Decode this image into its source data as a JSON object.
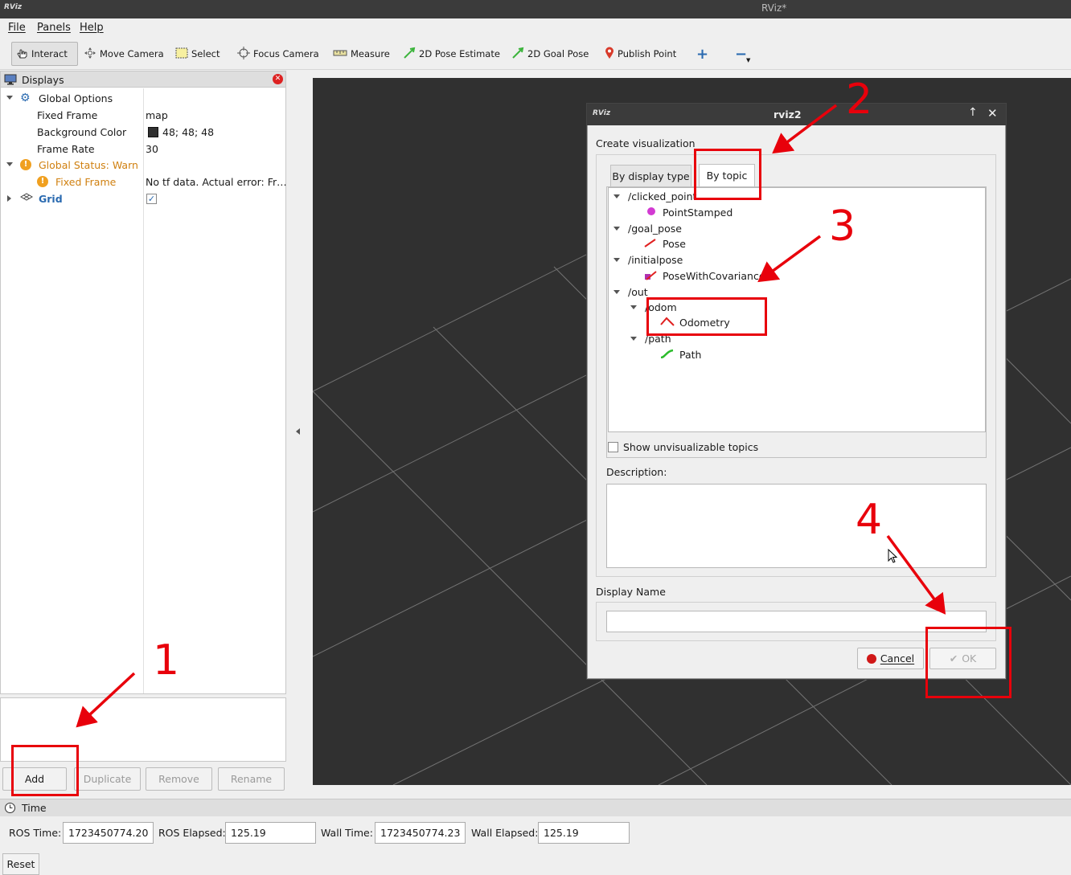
{
  "window": {
    "logo": "RViz",
    "title": "RViz*"
  },
  "menu": {
    "file": "File",
    "panels": "Panels",
    "help": "Help"
  },
  "toolbar": {
    "interact": "Interact",
    "move_camera": "Move Camera",
    "select": "Select",
    "focus_camera": "Focus Camera",
    "measure": "Measure",
    "pose_estimate": "2D Pose Estimate",
    "goal_pose": "2D Goal Pose",
    "publish_point": "Publish Point"
  },
  "displays": {
    "title": "Displays",
    "rows": {
      "global_options": "Global Options",
      "fixed_frame_label": "Fixed Frame",
      "fixed_frame_value": "map",
      "bg_color_label": "Background Color",
      "bg_color_value": "48; 48; 48",
      "frame_rate_label": "Frame Rate",
      "frame_rate_value": "30",
      "global_status": "Global Status: Warn",
      "status_fixed_frame": "Fixed Frame",
      "status_error": "No tf data.  Actual error: Fr…",
      "grid": "Grid"
    },
    "buttons": {
      "add": "Add",
      "duplicate": "Duplicate",
      "remove": "Remove",
      "rename": "Rename"
    }
  },
  "time": {
    "title": "Time",
    "ros_time_label": "ROS Time:",
    "ros_time": "1723450774.20",
    "ros_elapsed_label": "ROS Elapsed:",
    "ros_elapsed": "125.19",
    "wall_time_label": "Wall Time:",
    "wall_time": "1723450774.23",
    "wall_elapsed_label": "Wall Elapsed:",
    "wall_elapsed": "125.19",
    "reset": "Reset"
  },
  "dialog": {
    "logo": "RViz",
    "title": "rviz2",
    "section": "Create visualization",
    "tab_display_type": "By display type",
    "tab_topic": "By topic",
    "topics": {
      "clicked_point": "/clicked_point",
      "point_stamped": "PointStamped",
      "goal_pose": "/goal_pose",
      "pose": "Pose",
      "initialpose": "/initialpose",
      "pose_cov": "PoseWithCovariance",
      "out": "/out",
      "odom": "/odom",
      "odometry": "Odometry",
      "path_topic": "/path",
      "path": "Path"
    },
    "show_unvis": "Show unvisualizable topics",
    "description_label": "Description:",
    "display_name_label": "Display Name",
    "display_name_value": "",
    "cancel": "Cancel",
    "ok": "OK"
  },
  "annotations": {
    "n1": "1",
    "n2": "2",
    "n3": "3",
    "n4": "4"
  },
  "colors": {
    "annotation_red": "#e8000b",
    "viewport_bg": "#303030",
    "warn": "#d08010"
  }
}
